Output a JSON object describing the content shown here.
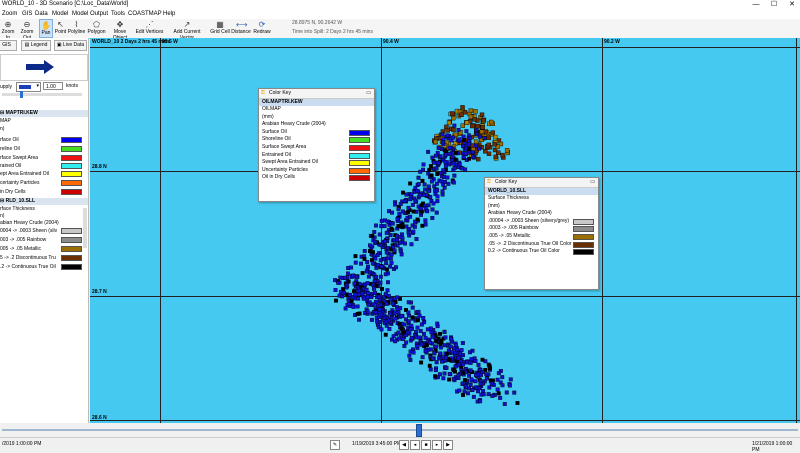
{
  "window": {
    "title": "WORLD_10 - 3D Scenario [C:\\Loc_Data\\World]",
    "min": "—",
    "max": "☐",
    "close": "✕"
  },
  "menu": [
    "Zoom",
    "GIS",
    "Data",
    "Model",
    "Model Output",
    "Tools",
    "COASTMAP",
    "Help"
  ],
  "toolbar": {
    "buttons": [
      {
        "label": "Zoom In",
        "icon": "magnifier-plus-icon"
      },
      {
        "label": "Zoom Out",
        "icon": "magnifier-minus-icon"
      },
      {
        "label": "Pan",
        "icon": "hand-icon"
      },
      {
        "label": "Point",
        "icon": "pointer-icon"
      },
      {
        "label": "Polyline",
        "icon": "polyline-icon"
      },
      {
        "label": "Polygon",
        "icon": "polygon-icon"
      },
      {
        "label": "Move Object",
        "icon": "move-icon"
      },
      {
        "label": "Edit Vertices",
        "icon": "vertices-icon"
      },
      {
        "label": "Add Current Vector",
        "icon": "vector-icon"
      },
      {
        "label": "Grid Cell",
        "icon": "grid-icon"
      },
      {
        "label": "Distance",
        "icon": "ruler-icon"
      },
      {
        "label": "Redraw",
        "icon": "refresh-icon"
      }
    ],
    "coords": "28.8975 N, 90.2642 W",
    "timeinfo": "Time into Spill: 2 Days 2 hrs 45 mins"
  },
  "leftpanel": {
    "tabs": [
      "GIS",
      "Legend",
      "Live Data"
    ],
    "wind": {
      "label": "upply",
      "speed": "1.00",
      "unit": "knots"
    },
    "sections": [
      {
        "title": "MAPTRI.KEW",
        "sub": "MAP",
        "unit": "n)",
        "items": [
          {
            "label": "rface Oil",
            "color": "#0000ee"
          },
          {
            "label": "reline Oil",
            "color": "#44dd22"
          },
          {
            "label": "rface Swept Area",
            "color": "#ee1111"
          },
          {
            "label": "rained Oil",
            "color": "#33eeee"
          },
          {
            "label": "ept Area Entrained Oil",
            "color": "#ffff00"
          },
          {
            "label": "certainty Particles",
            "color": "#ff6a00"
          },
          {
            "label": "in Dry Cells",
            "color": "#cc0000"
          }
        ]
      },
      {
        "title": "RLD_10.SLL",
        "sub": "rface Thickness",
        "unit": "n)",
        "oil": "abian Heavy Crude (2004)",
        "items": [
          {
            "label": "0004 -> .0003 Sheen (silv",
            "color": "#c8c8c8"
          },
          {
            "label": "003 -> .005 Rainbow",
            "color": "#8c8c8c"
          },
          {
            "label": "005 -> .05 Metallic",
            "color": "#9a6e00"
          },
          {
            "label": "5 -> .2 Discontinuous Tru",
            "color": "#6b2e00"
          },
          {
            "label": ".2 -> Continuous True Oil",
            "color": "#000000"
          }
        ]
      }
    ]
  },
  "map": {
    "header": "WORLD_10 2 Days 2 hrs 45 mins",
    "lon_labels": [
      "90.5 W",
      "90.4 W",
      "90.2 W"
    ],
    "lat_labels": [
      "28.8 N",
      "28.7 N",
      "28.6 N"
    ]
  },
  "colorkey1": {
    "title": "Color Key",
    "name": "OILMAPTRI.KEW",
    "sub": "OILMAP",
    "unit": "(mm)",
    "oil": "Arabian Heavy Crude (2004)",
    "items": [
      {
        "label": "Surface Oil",
        "color": "#0000ee"
      },
      {
        "label": "Shoreline Oil",
        "color": "#44dd22"
      },
      {
        "label": "Surface Swept Area",
        "color": "#ee1111"
      },
      {
        "label": "Entrained Oil",
        "color": "#33eeee"
      },
      {
        "label": "Swept Area Entrained Oil",
        "color": "#ffff00"
      },
      {
        "label": "Uncertainty Particles",
        "color": "#ff6a00"
      },
      {
        "label": "Oil in Dry Cells",
        "color": "#cc0000"
      }
    ]
  },
  "colorkey2": {
    "title": "Color Key",
    "name": "WORLD_10.SLL",
    "sub": "Surface Thickness",
    "unit": "(mm)",
    "oil": "Arabian Heavy Crude (2004)",
    "items": [
      {
        "label": ".00004 -> .0003 Sheen (silvery/grey)",
        "color": "#c8c8c8"
      },
      {
        "label": ".0003 -> .005 Rainbow",
        "color": "#8c8c8c"
      },
      {
        "label": ".005 -> .05 Metallic",
        "color": "#9a6e00"
      },
      {
        "label": ".05 -> .2 Discontinuous True Oil Color",
        "color": "#6b2e00"
      },
      {
        "label": "0.2 -> Continuous True Oil Color",
        "color": "#000000"
      }
    ]
  },
  "status": {
    "left": "/2019 1:00:00 PM",
    "center": "1/19/2019 3:45:00 PM",
    "right": "1/21/2019 1:00:00 PM"
  }
}
